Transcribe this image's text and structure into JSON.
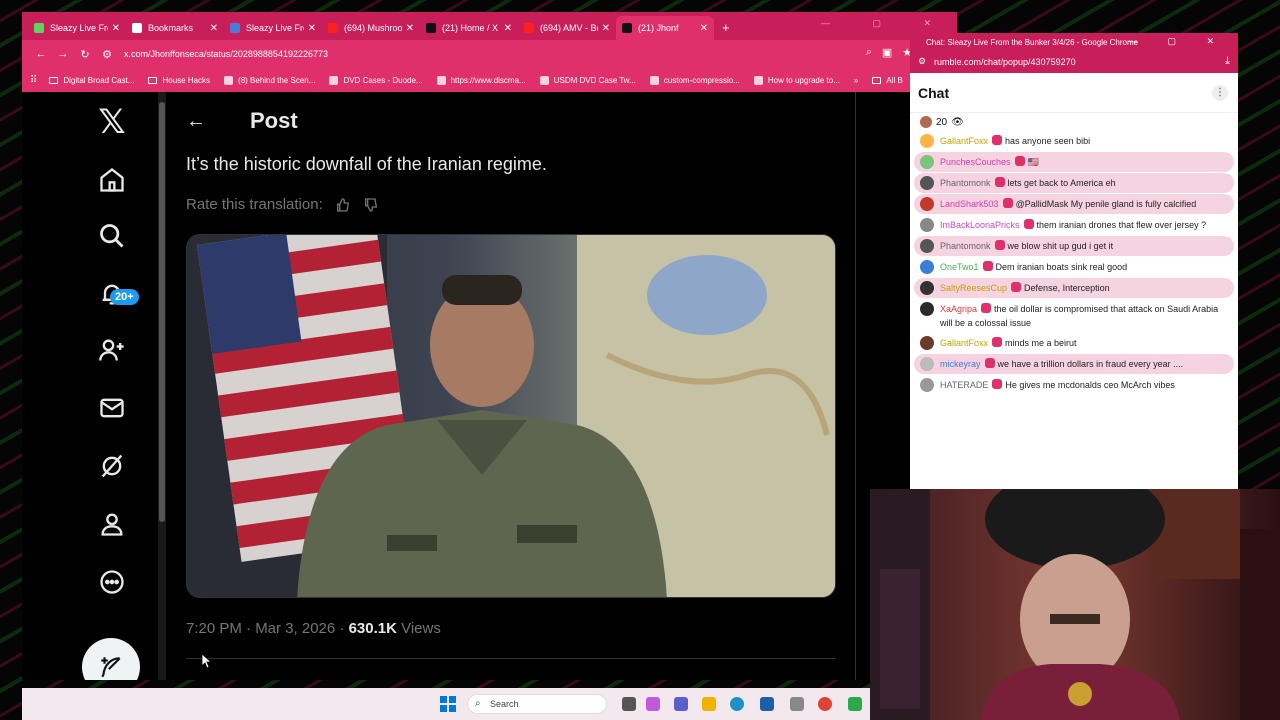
{
  "browser": {
    "tabs": [
      {
        "label": "Sleazy Live Fro",
        "color": "#5fd35f"
      },
      {
        "label": "Bookmarks",
        "color": "#ffffff"
      },
      {
        "label": "Sleazy Live Fro",
        "color": "#4a7bd8"
      },
      {
        "label": "(694) Mushroo",
        "color": "#ff2020"
      },
      {
        "label": "(21) Home / X",
        "color": "#111111"
      },
      {
        "label": "(694) AMV - Be",
        "color": "#ff2020"
      },
      {
        "label": "(21) Jhonf",
        "color": "#111111"
      }
    ],
    "new_tab": "+",
    "url": "x.com/Jhonffonseca/status/2028988854192226773",
    "bookmarks": [
      {
        "label": "Digital Broad Cast...",
        "folder": true
      },
      {
        "label": "House Hacks",
        "folder": true
      },
      {
        "label": "(8) Behind the Scen...",
        "folder": false
      },
      {
        "label": "DVD Cases - Duode...",
        "folder": false
      },
      {
        "label": "https://www.discma...",
        "folder": false
      },
      {
        "label": "USDM DVD Case Tw...",
        "folder": false
      },
      {
        "label": "custom-compressio...",
        "folder": false
      },
      {
        "label": "How to upgrade to...",
        "folder": false
      }
    ],
    "bookmarks_more": "»",
    "all_bookmarks": "All B"
  },
  "xnav": {
    "notifications_badge": "20+"
  },
  "post": {
    "header": "Post",
    "back": "←",
    "translated_text": "It’s the historic downfall of the Iranian regime.",
    "rate_label": "Rate this translation:",
    "time": "7:20 PM · Mar 3, 2026 · ",
    "views_count": "630.1K",
    "views_label": " Views"
  },
  "chat": {
    "window_title": "Chat: Sleazy Live From the Bunker 3/4/26 - Google Chrome",
    "url": "rumble.com/chat/popup/430759270",
    "header": "Chat",
    "viewers": "20",
    "messages": [
      {
        "user": "GallantFoxx",
        "color": "#c8a000",
        "text": "has anyone seen bibi",
        "alt": false,
        "avatar": "#ffb347"
      },
      {
        "user": "PunchesCouches",
        "color": "#d63cb0",
        "text": "🇺🇸",
        "alt": true,
        "avatar": "#7bc47b"
      },
      {
        "user": "Phantomonk",
        "color": "#666666",
        "text": "lets get back to America eh",
        "alt": true,
        "avatar": "#555555"
      },
      {
        "user": "LandShark503",
        "color": "#d63cb0",
        "text": "@PallidMask My penile gland is fully calcified",
        "alt": true,
        "avatar": "#c0392b"
      },
      {
        "user": "ImBackLoonaPricks",
        "color": "#c04ad0",
        "text": "them iranian drones that flew over jersey ?",
        "alt": false,
        "avatar": "#888888"
      },
      {
        "user": "Phantomonk",
        "color": "#666666",
        "text": "we blow shit up gud i get it",
        "alt": true,
        "avatar": "#555555"
      },
      {
        "user": "OneTwo1",
        "color": "#4caf50",
        "text": "Dem iranian boats sink real good",
        "alt": false,
        "avatar": "#3b7dd8"
      },
      {
        "user": "SaltyReesesCup",
        "color": "#c8a000",
        "text": "Defense, Interception",
        "alt": true,
        "avatar": "#333333"
      },
      {
        "user": "XaAgripa",
        "color": "#d63c3c",
        "text": "the oil dollar is compromised that attack on Saudi Arabia will be a colossal issue",
        "alt": false,
        "avatar": "#2a2a2a"
      },
      {
        "user": "GallantFoxx",
        "color": "#c8a000",
        "text": "minds me a beirut",
        "alt": false,
        "avatar": "#6b3a2a"
      },
      {
        "user": "mickeyray",
        "color": "#3b7dd8",
        "text": "we have a trillion dollars in fraud every year ....",
        "alt": true,
        "avatar": "#bbbbbb"
      },
      {
        "user": "HATERADE",
        "color": "#666666",
        "text": "He gives me mcdonalds ceo McArch vibes",
        "alt": false,
        "avatar": "#999999"
      }
    ]
  },
  "taskbar": {
    "search_placeholder": "Search"
  }
}
